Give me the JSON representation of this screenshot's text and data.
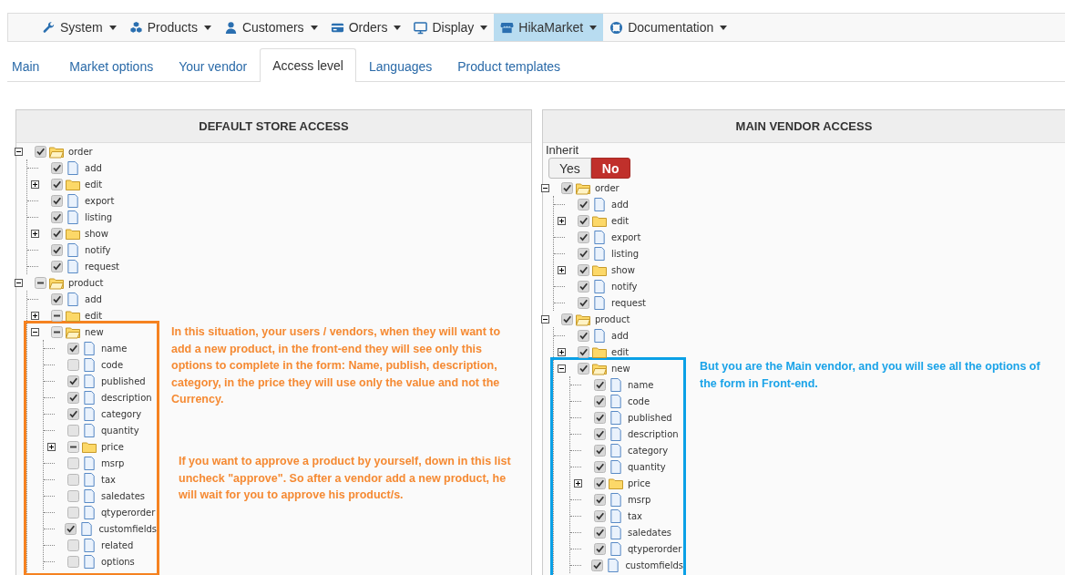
{
  "nav": [
    {
      "label": "System",
      "kind": "wrench",
      "selected": false
    },
    {
      "label": "Products",
      "kind": "cubes",
      "selected": false
    },
    {
      "label": "Customers",
      "kind": "user",
      "selected": false
    },
    {
      "label": "Orders",
      "kind": "card",
      "selected": false
    },
    {
      "label": "Display",
      "kind": "monitor",
      "selected": false
    },
    {
      "label": "HikaMarket",
      "kind": "store",
      "selected": true
    },
    {
      "label": "Documentation",
      "kind": "lifering",
      "selected": false
    }
  ],
  "tabs": [
    {
      "label": "Main",
      "selected": false
    },
    {
      "label": "Market options",
      "selected": false
    },
    {
      "label": "Your vendor",
      "selected": false
    },
    {
      "label": "Access level",
      "selected": true
    },
    {
      "label": "Languages",
      "selected": false
    },
    {
      "label": "Product templates",
      "selected": false
    }
  ],
  "panels": [
    {
      "title": "DEFAULT STORE ACCESS",
      "tree": [
        {
          "label": "order",
          "kind": "folder",
          "checked": true,
          "partial": false,
          "expanded": true,
          "children": [
            {
              "label": "add",
              "kind": "file",
              "checked": true
            },
            {
              "label": "edit",
              "kind": "folder",
              "checked": true,
              "partial": false,
              "expanded": false
            },
            {
              "label": "export",
              "kind": "file",
              "checked": true
            },
            {
              "label": "listing",
              "kind": "file",
              "checked": true
            },
            {
              "label": "show",
              "kind": "folder",
              "checked": true,
              "partial": false,
              "expanded": false
            },
            {
              "label": "notify",
              "kind": "file",
              "checked": true
            },
            {
              "label": "request",
              "kind": "file",
              "checked": true
            }
          ]
        },
        {
          "label": "product",
          "kind": "folder",
          "checked": false,
          "partial": true,
          "expanded": true,
          "children": [
            {
              "label": "add",
              "kind": "file",
              "checked": true
            },
            {
              "label": "edit",
              "kind": "folder",
              "checked": false,
              "partial": true,
              "expanded": false
            },
            {
              "label": "new",
              "kind": "folder",
              "checked": false,
              "partial": true,
              "expanded": true,
              "highlighted": true,
              "color": "#f58220",
              "children": [
                {
                  "label": "name",
                  "kind": "file",
                  "checked": true
                },
                {
                  "label": "code",
                  "kind": "file",
                  "checked": false
                },
                {
                  "label": "published",
                  "kind": "file",
                  "checked": true
                },
                {
                  "label": "description",
                  "kind": "file",
                  "checked": true
                },
                {
                  "label": "category",
                  "kind": "file",
                  "checked": true
                },
                {
                  "label": "quantity",
                  "kind": "file",
                  "checked": false
                },
                {
                  "label": "price",
                  "kind": "folder",
                  "checked": false,
                  "partial": true,
                  "expanded": false
                },
                {
                  "label": "msrp",
                  "kind": "file",
                  "checked": false
                },
                {
                  "label": "tax",
                  "kind": "file",
                  "checked": false
                },
                {
                  "label": "saledates",
                  "kind": "file",
                  "checked": false
                },
                {
                  "label": "qtyperorder",
                  "kind": "file",
                  "checked": false
                },
                {
                  "label": "customfields",
                  "kind": "file",
                  "checked": true
                },
                {
                  "label": "related",
                  "kind": "file",
                  "checked": false
                },
                {
                  "label": "options",
                  "kind": "file",
                  "checked": false
                }
              ]
            }
          ]
        }
      ],
      "notes": [
        {
          "text": "In this situation, your users / vendors, when they will want to add a new product, in the front-end they will see only this options to complete in the form: Name, publish, description, category, in the price they will use only the value and not the Currency.",
          "color": "#f58a33"
        },
        {
          "text": "If you want to approve a product by yourself, down in this list uncheck \"approve\". So after a vendor add a new product, he will wait for you to approve his product/s.",
          "color": "#f58a33"
        }
      ]
    },
    {
      "title": "MAIN VENDOR ACCESS",
      "inherit": {
        "label": "Inherit",
        "options": [
          {
            "label": "Yes",
            "selected": false
          },
          {
            "label": "No",
            "selected": true
          }
        ]
      },
      "tree": [
        {
          "label": "order",
          "kind": "folder",
          "checked": true,
          "partial": false,
          "expanded": true,
          "children": [
            {
              "label": "add",
              "kind": "file",
              "checked": true
            },
            {
              "label": "edit",
              "kind": "folder",
              "checked": true,
              "partial": false,
              "expanded": false
            },
            {
              "label": "export",
              "kind": "file",
              "checked": true
            },
            {
              "label": "listing",
              "kind": "file",
              "checked": true
            },
            {
              "label": "show",
              "kind": "folder",
              "checked": true,
              "partial": false,
              "expanded": false
            },
            {
              "label": "notify",
              "kind": "file",
              "checked": true
            },
            {
              "label": "request",
              "kind": "file",
              "checked": true
            }
          ]
        },
        {
          "label": "product",
          "kind": "folder",
          "checked": true,
          "partial": false,
          "expanded": true,
          "children": [
            {
              "label": "add",
              "kind": "file",
              "checked": true
            },
            {
              "label": "edit",
              "kind": "folder",
              "checked": true,
              "partial": false,
              "expanded": false
            },
            {
              "label": "new",
              "kind": "folder",
              "checked": true,
              "partial": false,
              "expanded": true,
              "highlighted": true,
              "color": "#0aa0e6",
              "children": [
                {
                  "label": "name",
                  "kind": "file",
                  "checked": true
                },
                {
                  "label": "code",
                  "kind": "file",
                  "checked": true
                },
                {
                  "label": "published",
                  "kind": "file",
                  "checked": true
                },
                {
                  "label": "description",
                  "kind": "file",
                  "checked": true
                },
                {
                  "label": "category",
                  "kind": "file",
                  "checked": true
                },
                {
                  "label": "quantity",
                  "kind": "file",
                  "checked": true
                },
                {
                  "label": "price",
                  "kind": "folder",
                  "checked": true,
                  "partial": false,
                  "expanded": false
                },
                {
                  "label": "msrp",
                  "kind": "file",
                  "checked": true
                },
                {
                  "label": "tax",
                  "kind": "file",
                  "checked": true
                },
                {
                  "label": "saledates",
                  "kind": "file",
                  "checked": true
                },
                {
                  "label": "qtyperorder",
                  "kind": "file",
                  "checked": true
                },
                {
                  "label": "customfields",
                  "kind": "file",
                  "checked": true
                }
              ]
            }
          ]
        }
      ],
      "notes": [
        {
          "text": "But you are the Main vendor, and you will see all the options of the form in Front-end.",
          "color": "#1aa3e8"
        }
      ]
    }
  ]
}
